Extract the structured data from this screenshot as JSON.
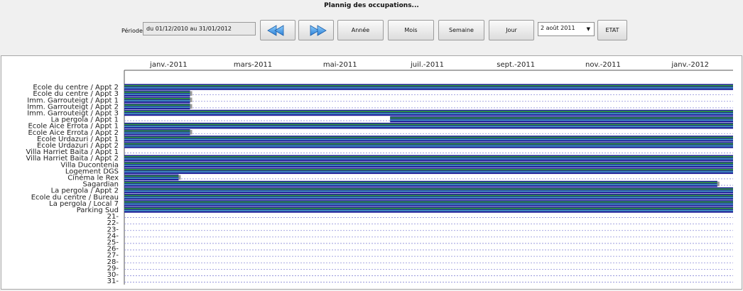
{
  "header": {
    "title": "Plannig des occupations..."
  },
  "toolbar": {
    "period_label": "Période",
    "period_value": "du  01/12/2010  au  31/01/2012",
    "prev_icon": "double-arrow-left-icon",
    "next_icon": "double-arrow-right-icon",
    "year_label": "Année",
    "month_label": "Mois",
    "week_label": "Semaine",
    "day_label": "Jour",
    "date_select": "2 août 2011",
    "state_label": "ETAT"
  },
  "colors": {
    "bar_blue": "#23239a",
    "bar_green": "#2f9440",
    "bar_teal": "#46a6c4",
    "free_gap": "#ffffff",
    "end_marker": "#9a9a9a",
    "grid_dashed": "#8a8ad8"
  },
  "chart_data": {
    "type": "gantt",
    "x_axis": {
      "range": [
        "2010-12-01",
        "2012-01-31"
      ],
      "tick_labels": [
        "janv.-2011",
        "mars-2011",
        "mai-2011",
        "juil.-2011",
        "sept.-2011",
        "nov.-2011",
        "janv.-2012"
      ],
      "tick_dates": [
        "2011-01-01",
        "2011-03-01",
        "2011-05-01",
        "2011-07-01",
        "2011-09-01",
        "2011-11-01",
        "2012-01-01"
      ],
      "position": "top"
    },
    "rows": [
      {
        "label": "Ecole du centre / Appt 2",
        "segments": [
          [
            "2010-12-01",
            "2012-01-31"
          ]
        ]
      },
      {
        "label": "Ecole du centre / Appt 3",
        "segments": [
          [
            "2010-12-01",
            "2011-01-16"
          ]
        ]
      },
      {
        "label": "Imm. Garrouteigt / Appt 1",
        "segments": [
          [
            "2010-12-01",
            "2011-01-16"
          ]
        ]
      },
      {
        "label": "Imm. Garrouteigt / Appt 2",
        "segments": [
          [
            "2010-12-01",
            "2011-01-16"
          ]
        ]
      },
      {
        "label": "Imm. Garrouteigt / Appt 3",
        "segments": [
          [
            "2010-12-01",
            "2012-01-31"
          ]
        ]
      },
      {
        "label": "La pergola / Appt 1",
        "segments": [
          [
            "2011-06-05",
            "2012-01-31"
          ]
        ]
      },
      {
        "label": "Ecole Aice Errota / Appt 1",
        "segments": [
          [
            "2010-12-01",
            "2012-01-31"
          ]
        ]
      },
      {
        "label": "Ecole Aice Errota / Appt 2",
        "segments": [
          [
            "2010-12-01",
            "2011-01-16"
          ]
        ]
      },
      {
        "label": "Ecole Urdazuri / Appt 1",
        "segments": [
          [
            "2010-12-01",
            "2012-01-31"
          ]
        ]
      },
      {
        "label": "Ecole Urdazuri / Appt 2",
        "segments": [
          [
            "2010-12-01",
            "2012-01-31"
          ]
        ]
      },
      {
        "label": "Villa Harriet Baita / Appt 1",
        "segments": []
      },
      {
        "label": "Villa Harriet Baita / Appt 2",
        "segments": [
          [
            "2010-12-01",
            "2012-01-31"
          ]
        ]
      },
      {
        "label": "Villa Ducontenia",
        "segments": [
          [
            "2010-12-01",
            "2012-01-31"
          ]
        ]
      },
      {
        "label": "Logement DGS",
        "segments": [
          [
            "2010-12-01",
            "2012-01-31"
          ]
        ]
      },
      {
        "label": "Cinéma le Rex",
        "segments": [
          [
            "2010-12-01",
            "2011-01-08"
          ]
        ]
      },
      {
        "label": "Sagardian",
        "segments": [
          [
            "2010-12-01",
            "2012-01-20"
          ]
        ]
      },
      {
        "label": "La pergola / Appt 2",
        "segments": [
          [
            "2010-12-01",
            "2012-01-31"
          ]
        ]
      },
      {
        "label": "Ecole du centre / Bureau",
        "segments": [
          [
            "2010-12-01",
            "2012-01-31"
          ]
        ]
      },
      {
        "label": "La pergola / Local 7",
        "segments": [
          [
            "2010-12-01",
            "2012-01-31"
          ]
        ]
      },
      {
        "label": "Parking Sud",
        "segments": [
          [
            "2010-12-01",
            "2012-01-31"
          ]
        ]
      },
      {
        "label": "21-",
        "segments": []
      },
      {
        "label": "22-",
        "segments": []
      },
      {
        "label": "23-",
        "segments": []
      },
      {
        "label": "24-",
        "segments": []
      },
      {
        "label": "25-",
        "segments": []
      },
      {
        "label": "26-",
        "segments": []
      },
      {
        "label": "27-",
        "segments": []
      },
      {
        "label": "28-",
        "segments": []
      },
      {
        "label": "29-",
        "segments": []
      },
      {
        "label": "30-",
        "segments": []
      },
      {
        "label": "31-",
        "segments": []
      }
    ]
  }
}
